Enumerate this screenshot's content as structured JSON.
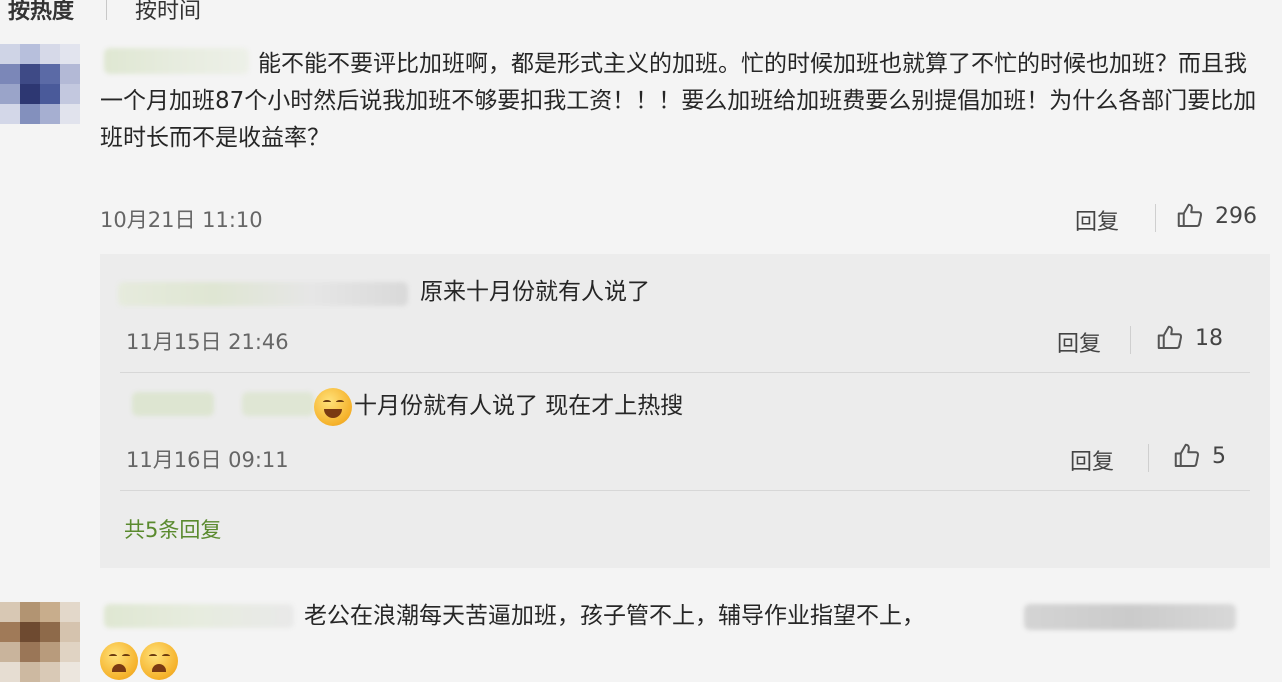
{
  "sort_tabs": {
    "hot": "按热度",
    "time": "按时间"
  },
  "comment1": {
    "text": "能不能不要评比加班啊，都是形式主义的加班。忙的时候加班也就算了不忙的时候也加班？而且我一个月加班87个小时然后说我加班不够要扣我工资！！！要么加班给加班费要么别提倡加班！为什么各部门要比加班时长而不是收益率？",
    "time": "10月21日 11:10",
    "reply_label": "回复",
    "likes": "296"
  },
  "replies": [
    {
      "text": "原来十月份就有人说了",
      "time": "11月15日 21:46",
      "reply_label": "回复",
      "likes": "18",
      "emoji": ""
    },
    {
      "text": "十月份就有人说了 现在才上热搜",
      "time": "11月16日 09:11",
      "reply_label": "回复",
      "likes": "5",
      "emoji": "laughing-tears"
    }
  ],
  "more_replies": "共5条回复",
  "comment2": {
    "text": "老公在浪潮每天苦逼加班，孩子管不上，辅导作业指望不上，",
    "emoji": "crying-face"
  },
  "colors": {
    "page_bg": "#f4f4f4",
    "reply_bg": "#ececec",
    "link_green": "#5a8a2e"
  },
  "icons": {
    "like": "thumbs-up-icon"
  }
}
